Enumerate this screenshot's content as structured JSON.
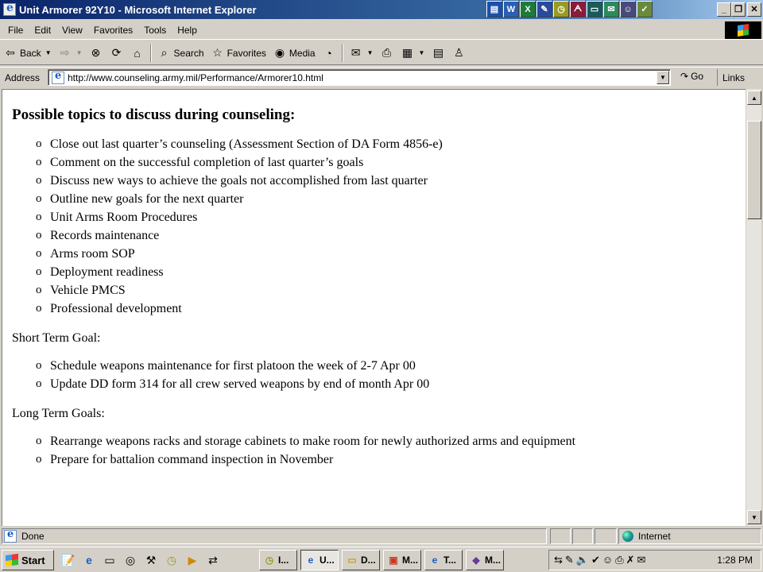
{
  "window": {
    "title": "Unit Armorer 92Y10 - Microsoft Internet Explorer",
    "title_tray_icons": [
      "document-icon",
      "word-icon",
      "excel-icon",
      "publisher-icon",
      "clock-icon",
      "access-icon",
      "desktop-icon",
      "outlook-icon",
      "grip-icon",
      "notepad-icon"
    ],
    "buttons": {
      "minimize": "_",
      "restore": "❐",
      "close": "✕"
    }
  },
  "menu": [
    "File",
    "Edit",
    "View",
    "Favorites",
    "Tools",
    "Help"
  ],
  "toolbar": {
    "back": "Back",
    "search": "Search",
    "favorites": "Favorites",
    "media": "Media"
  },
  "address": {
    "label": "Address",
    "url": "http://www.counseling.army.mil/Performance/Armorer10.html",
    "go": "Go",
    "links": "Links"
  },
  "content": {
    "heading": "Possible topics to discuss during counseling:",
    "topics": [
      "Close out last quarter’s counseling (Assessment Section of DA Form 4856-e)",
      "Comment on the successful completion of last quarter’s goals",
      "Discuss new ways to achieve the goals not accomplished from last quarter",
      "Outline new goals for the next quarter",
      "Unit Arms Room Procedures",
      "Records maintenance",
      "Arms room SOP",
      "Deployment readiness",
      "Vehicle PMCS",
      "Professional development"
    ],
    "short_term_label": "Short Term Goal:",
    "short_term": [
      "Schedule weapons maintenance for first platoon the week of 2-7 Apr 00",
      "Update DD form 314 for all crew served weapons by end of month Apr 00"
    ],
    "long_term_label": "Long Term Goals:",
    "long_term": [
      "Rearrange weapons racks and storage cabinets to make room for newly authorized arms and equipment",
      "Prepare for battalion command inspection in November"
    ]
  },
  "status": {
    "text": "Done",
    "zone": "Internet"
  },
  "taskbar": {
    "start": "Start",
    "tasks": [
      {
        "label": "I...",
        "icon": "clock-icon"
      },
      {
        "label": "U...",
        "icon": "ie-icon",
        "active": true
      },
      {
        "label": "D...",
        "icon": "folder-icon"
      },
      {
        "label": "M...",
        "icon": "powerpoint-icon"
      },
      {
        "label": "T...",
        "icon": "ie-icon"
      },
      {
        "label": "M...",
        "icon": "paint-icon"
      }
    ],
    "clock": "1:28 PM"
  }
}
